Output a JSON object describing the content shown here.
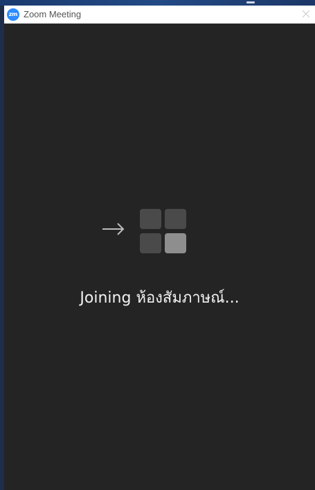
{
  "window": {
    "title": "Zoom Meeting",
    "logo_text": "zm",
    "logo_color": "#2d8cff"
  },
  "status": {
    "text": "Joining ห้องสัมภาษณ์..."
  },
  "icons": {
    "arrow": "arrow-right-icon",
    "grid": "grid-tiles-icon",
    "close": "close-icon"
  },
  "colors": {
    "background": "#242424",
    "titlebar": "#ffffff",
    "tile": "#4a4a4a",
    "tile_active": "#8e8e8e"
  }
}
